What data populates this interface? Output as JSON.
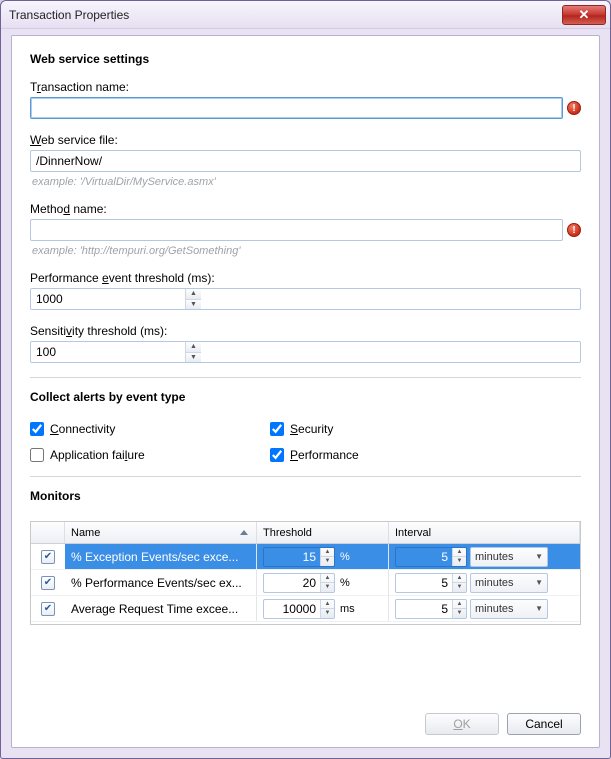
{
  "window": {
    "title": "Transaction Properties"
  },
  "sections": {
    "web_service": {
      "heading": "Web service settings",
      "transaction_name_label_pre": "T",
      "transaction_name_label_u": "r",
      "transaction_name_label_post": "ansaction name:",
      "transaction_name_value": "",
      "web_file_label_u": "W",
      "web_file_label_post": "eb service file:",
      "web_file_value": "/DinnerNow/",
      "web_file_hint": "example: '/VirtualDir/MyService.asmx'",
      "method_label_pre": "Metho",
      "method_label_u": "d",
      "method_label_post": " name:",
      "method_value": "",
      "method_hint": "example: 'http://tempuri.org/GetSomething'",
      "perf_label_pre": "Performance ",
      "perf_label_u": "e",
      "perf_label_post": "vent threshold (ms):",
      "perf_value": "1000",
      "sens_label_pre": "Sensiti",
      "sens_label_u": "v",
      "sens_label_post": "ity threshold (ms):",
      "sens_value": "100"
    },
    "alerts": {
      "heading": "Collect alerts by event type",
      "items": [
        {
          "label_u": "C",
          "label_post": "onnectivity",
          "checked": true
        },
        {
          "label_u": "S",
          "label_post": "ecurity",
          "checked": true
        },
        {
          "label_pre": "Application fai",
          "label_u": "l",
          "label_post": "ure",
          "checked": false
        },
        {
          "label_u": "P",
          "label_post": "erformance",
          "checked": true
        }
      ]
    },
    "monitors": {
      "heading": "Monitors",
      "columns": {
        "name": "Name",
        "threshold": "Threshold",
        "interval": "Interval"
      },
      "rows": [
        {
          "checked": true,
          "selected": true,
          "name": "% Exception Events/sec exce...",
          "threshold": "15",
          "unit": "%",
          "interval": "5",
          "interval_unit": "minutes"
        },
        {
          "checked": true,
          "selected": false,
          "name": "% Performance Events/sec ex...",
          "threshold": "20",
          "unit": "%",
          "interval": "5",
          "interval_unit": "minutes"
        },
        {
          "checked": true,
          "selected": false,
          "name": "Average Request Time excee...",
          "threshold": "10000",
          "unit": "ms",
          "interval": "5",
          "interval_unit": "minutes"
        }
      ]
    }
  },
  "footer": {
    "ok_u": "O",
    "ok_post": "K",
    "cancel": "Cancel"
  }
}
